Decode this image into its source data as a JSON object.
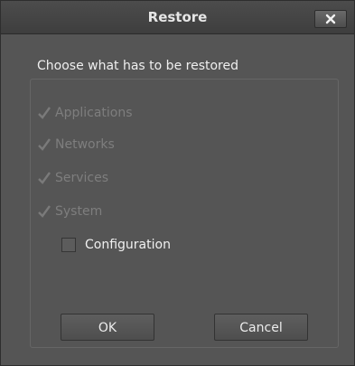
{
  "window": {
    "title": "Restore",
    "close_icon": "close-icon"
  },
  "group": {
    "label": "Choose what has to be restored",
    "items": [
      {
        "label": "Applications",
        "checked": true,
        "enabled": false
      },
      {
        "label": "Networks",
        "checked": true,
        "enabled": false
      },
      {
        "label": "Services",
        "checked": true,
        "enabled": false
      },
      {
        "label": "System",
        "checked": true,
        "enabled": false
      },
      {
        "label": "Configuration",
        "checked": false,
        "enabled": true
      }
    ]
  },
  "buttons": {
    "ok_label": "OK",
    "cancel_label": "Cancel"
  },
  "colors": {
    "background": "#555555",
    "titlebar": "#444444",
    "text": "#efefef",
    "disabled_text": "#7e7e7e"
  }
}
